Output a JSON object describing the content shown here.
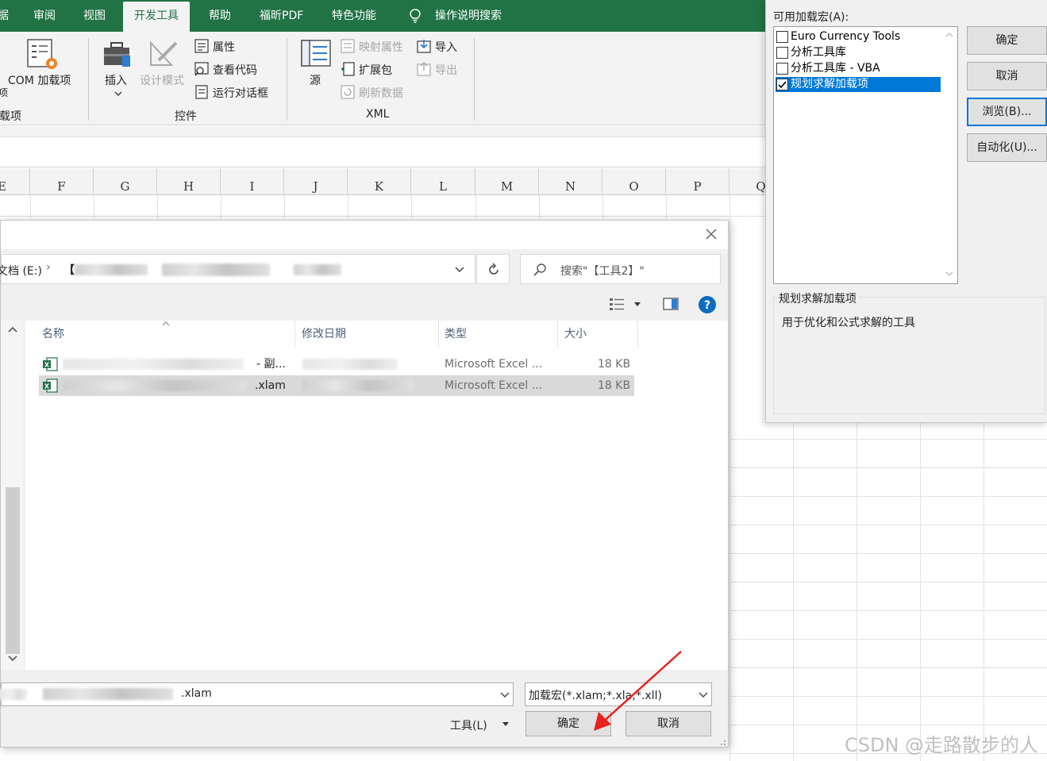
{
  "ribbon": {
    "tabs": [
      "据",
      "审阅",
      "视图",
      "开发工具",
      "帮助",
      "福昕PDF",
      "特色功能",
      "操作说明搜索"
    ],
    "active_tab": "开发工具",
    "addins_group": {
      "com_addins": "COM 加载项",
      "label": "载项"
    },
    "controls_group": {
      "insert": "插入",
      "design_mode": "设计模式",
      "properties": "属性",
      "view_code": "查看代码",
      "run_dialog": "运行对话框",
      "label": "控件"
    },
    "xml_group": {
      "source": "源",
      "map_properties": "映射属性",
      "expansion_packs": "扩展包",
      "refresh_data": "刷新数据",
      "import": "导入",
      "export": "导出",
      "label": "XML"
    }
  },
  "sheet": {
    "columns": [
      "F",
      "G",
      "H",
      "I",
      "J",
      "K",
      "L",
      "M",
      "N",
      "O",
      "P",
      "Q"
    ]
  },
  "file_dialog": {
    "address_prefix": "文档 (E:)",
    "address_bracket": "【",
    "search_placeholder": "搜索\"【工具2】\"",
    "columns": {
      "name": "名称",
      "modified": "修改日期",
      "type": "类型",
      "size": "大小"
    },
    "files": [
      {
        "name_suffix": "- 副...",
        "type": "Microsoft Excel ...",
        "size": "18 KB"
      },
      {
        "name_suffix": ".xlam",
        "type": "Microsoft Excel ...",
        "size": "18 KB"
      }
    ],
    "filename_suffix": ".xlam",
    "filetype": "加载宏(*.xlam;*.xla;*.xll)",
    "tools_label": "工具(L)",
    "ok_button": "确定",
    "cancel_button": "取消"
  },
  "addins_dialog": {
    "available_label": "可用加载宏(A):",
    "items": [
      {
        "label": "Euro Currency Tools",
        "checked": false
      },
      {
        "label": "分析工具库",
        "checked": false
      },
      {
        "label": "分析工具库 - VBA",
        "checked": false
      },
      {
        "label": "规划求解加载项",
        "checked": true
      }
    ],
    "buttons": {
      "ok": "确定",
      "cancel": "取消",
      "browse": "浏览(B)...",
      "automation": "自动化(U)..."
    },
    "description_title": "规划求解加载项",
    "description_text": "用于优化和公式求解的工具"
  },
  "watermark": "CSDN @走路散步的人",
  "colors": {
    "excel_green": "#217346",
    "selection_blue": "#0078d7",
    "arrow_red": "#e8211d"
  }
}
